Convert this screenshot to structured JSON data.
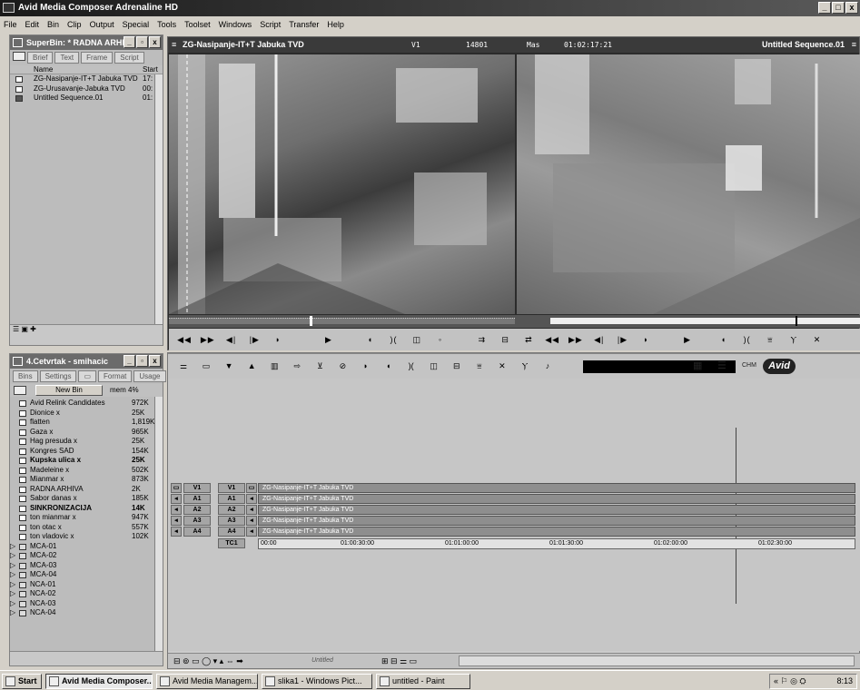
{
  "app": {
    "title": "Avid Media Composer Adrenaline HD",
    "win_min": "_",
    "win_max": "□",
    "win_close": "x"
  },
  "menu": [
    "File",
    "Edit",
    "Bin",
    "Clip",
    "Output",
    "Special",
    "Tools",
    "Toolset",
    "Windows",
    "Script",
    "Transfer",
    "Help"
  ],
  "superbin": {
    "title": "SuperBin: * RADNA ARHI...",
    "tabs": [
      "Brief",
      "Text",
      "Frame",
      "Script"
    ],
    "col_name": "Name",
    "col_start": "Start",
    "rows": [
      {
        "name": "ZG-Nasipanje-IT+T Jabuka TVD",
        "start": "17:"
      },
      {
        "name": "ZG-Urusavanje-Jabuka TVD",
        "start": "00:"
      },
      {
        "name": "Untitled Sequence.01",
        "start": "01:"
      }
    ]
  },
  "project": {
    "title": "4.Cetvrtak - smihacic",
    "tabs": [
      "Bins",
      "Settings",
      "Format",
      "Usage"
    ],
    "new_bin": "New Bin",
    "mem": "mem 4%",
    "bins": [
      {
        "name": "Avid Relink Candidates",
        "size": "972K",
        "bold": false
      },
      {
        "name": "Dionice x",
        "size": "25K",
        "bold": false
      },
      {
        "name": "flatten",
        "size": "1,819K",
        "bold": false
      },
      {
        "name": "Gaza x",
        "size": "965K",
        "bold": false
      },
      {
        "name": "Hag presuda x",
        "size": "25K",
        "bold": false
      },
      {
        "name": "Kongres SAD",
        "size": "154K",
        "bold": false
      },
      {
        "name": "Kupska ulica x",
        "size": "25K",
        "bold": true
      },
      {
        "name": "Madeleine x",
        "size": "502K",
        "bold": false
      },
      {
        "name": "Mianmar x",
        "size": "873K",
        "bold": false
      },
      {
        "name": "RADNA ARHIVA",
        "size": "2K",
        "bold": false
      },
      {
        "name": "Sabor danas x",
        "size": "185K",
        "bold": false
      },
      {
        "name": "SINKRONIZACIJA",
        "size": "14K",
        "bold": true
      },
      {
        "name": "ton mianmar x",
        "size": "947K",
        "bold": false
      },
      {
        "name": "ton otac x",
        "size": "557K",
        "bold": false
      },
      {
        "name": "ton vladovic x",
        "size": "102K",
        "bold": false
      }
    ],
    "folders": [
      "MCA-01",
      "MCA-02",
      "MCA-03",
      "MCA-04",
      "NCA-01",
      "NCA-02",
      "NCA-03",
      "NCA-04"
    ]
  },
  "monitor": {
    "source_name": "ZG-Nasipanje-IT+T Jabuka TVD",
    "track": "V1",
    "frames": "14801",
    "mas": "Mas",
    "timecode": "01:02:17:21",
    "record_name": "Untitled Sequence.01"
  },
  "timeline": {
    "logo": "Avid",
    "tracks": [
      {
        "src": "V1",
        "rec": "V1",
        "clip": "ZG-Nasipanje-IT+T Jabuka TVD"
      },
      {
        "src": "A1",
        "rec": "A1",
        "clip": "ZG-Nasipanje-IT+T Jabuka TVD"
      },
      {
        "src": "A2",
        "rec": "A2",
        "clip": "ZG-Nasipanje-IT+T Jabuka TVD"
      },
      {
        "src": "A3",
        "rec": "A3",
        "clip": "ZG-Nasipanje-IT+T Jabuka TVD"
      },
      {
        "src": "A4",
        "rec": "A4",
        "clip": "ZG-Nasipanje-IT+T Jabuka TVD"
      }
    ],
    "tc_label": "TC1",
    "tc_marks": [
      "00:00",
      "01:00:30:00",
      "01:01:00:00",
      "01:01:30:00",
      "01:02:00:00",
      "01:02:30:00"
    ],
    "sequence_label": "Untitled"
  },
  "taskbar": {
    "start": "Start",
    "items": [
      "Avid Media Composer...",
      "Avid Media Managem...",
      "slika1 - Windows Pict...",
      "untitled - Paint"
    ],
    "clock": "8:13"
  }
}
